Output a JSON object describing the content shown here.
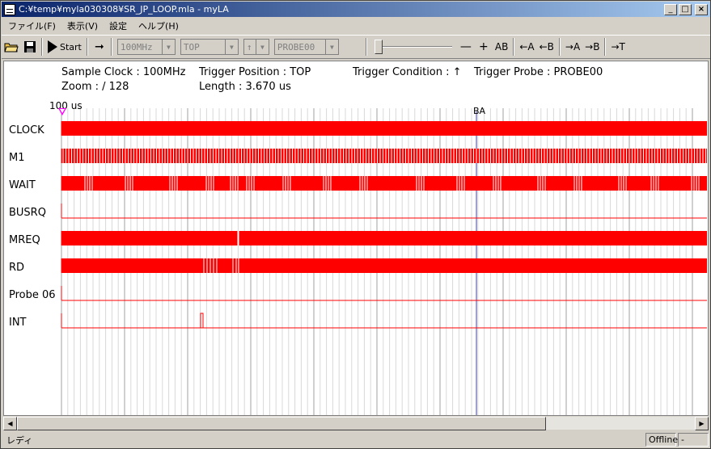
{
  "window": {
    "title": "C:¥temp¥myla030308¥SR_JP_LOOP.mla - myLA"
  },
  "caption_buttons": {
    "minimize": "_",
    "maximize": "□",
    "close": "×"
  },
  "menu": [
    {
      "label": "ファイル(F)"
    },
    {
      "label": "表示(V)"
    },
    {
      "label": "設定"
    },
    {
      "label": "ヘルプ(H)"
    }
  ],
  "toolbar": {
    "start_label": "Start",
    "arrow_label": "➞",
    "clock_combo": "100MHz",
    "position_combo": "TOP",
    "condition_combo": "↑",
    "probe_combo": "PROBE00",
    "zoom_out": "—",
    "zoom_in": "+",
    "cursor_ab": "AB",
    "goto_a_left": "←A",
    "goto_b_left": "←B",
    "goto_a_right": "→A",
    "goto_b_right": "→B",
    "goto_trigger": "→T"
  },
  "info": {
    "sample_clock": "Sample Clock : 100MHz",
    "zoom": "Zoom : / 128",
    "trigger_position": "Trigger Position : TOP",
    "length": "Length : 3.670 us",
    "trigger_condition": "Trigger Condition : ↑",
    "trigger_probe": "Trigger Probe : PROBE00"
  },
  "ruler": {
    "time_label": "100 us",
    "cursor_label": "BA"
  },
  "signals": [
    {
      "name": "CLOCK",
      "pattern": "solid"
    },
    {
      "name": "M1",
      "pattern": "dense"
    },
    {
      "name": "WAIT",
      "pattern": "blocks"
    },
    {
      "name": "BUSRQ",
      "pattern": "low"
    },
    {
      "name": "MREQ",
      "pattern": "solid_gap"
    },
    {
      "name": "RD",
      "pattern": "rd"
    },
    {
      "name": "Probe 06",
      "pattern": "low"
    },
    {
      "name": "INT",
      "pattern": "pulse"
    }
  ],
  "colors": {
    "signal": "#ff0000",
    "grid_major": "#a0a0a0",
    "grid_minor": "#d8d8d8",
    "cursor": "#8080c0"
  },
  "status": {
    "text": "レディ",
    "mode": "Offline",
    "extra": "-"
  },
  "scrollbar": {
    "left_arrow": "◀",
    "right_arrow": "▶"
  }
}
